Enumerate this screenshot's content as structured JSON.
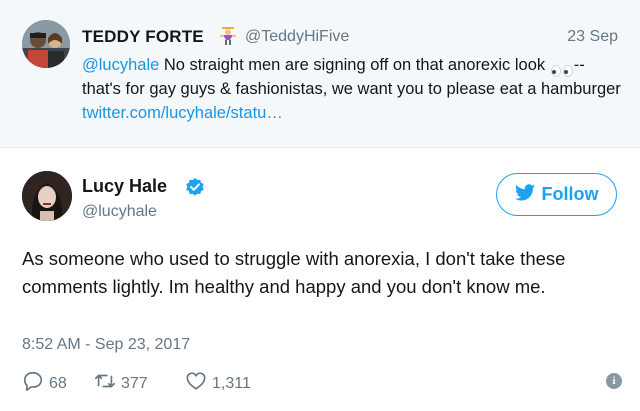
{
  "parent_tweet": {
    "author_name": "TEDDY FORTE",
    "author_handle": "@TeddyHiFive",
    "date": "23 Sep",
    "mention": "@lucyhale",
    "text_part1": " No straight men are signing off on that anorexic look ",
    "text_part2": "--that's for gay guys & fashionistas, we want you to please eat a hamburger ",
    "link": "twitter.com/lucyhale/statu…"
  },
  "tweet": {
    "author_name": "Lucy Hale",
    "author_handle": "@lucyhale",
    "follow_label": "Follow",
    "text": "As someone who used to struggle with anorexia, I don't take these comments lightly. Im healthy and happy and you don't know me.",
    "timestamp": "8:52 AM - Sep 23, 2017",
    "reply_count": "68",
    "retweet_count": "377",
    "like_count": "1,311"
  },
  "colors": {
    "accent": "#1da1f2",
    "link": "#1b95e0",
    "secondary_text": "#657786",
    "parent_background": "#f5f8fa"
  },
  "icons": [
    "emoji-icon",
    "eyes-icon",
    "verified-badge-icon",
    "twitter-bird-icon",
    "reply-icon",
    "retweet-icon",
    "like-icon",
    "info-icon"
  ]
}
